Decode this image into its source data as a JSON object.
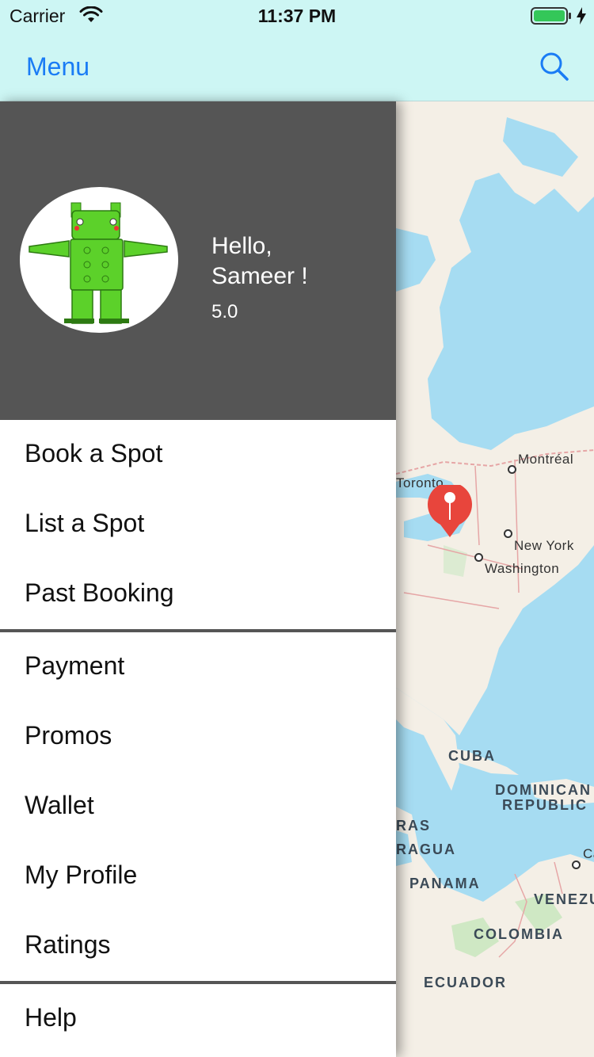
{
  "status_bar": {
    "carrier": "Carrier",
    "time": "11:37 PM"
  },
  "nav": {
    "title": "Menu",
    "icon": "search-icon",
    "accent_color": "#1a7cf5"
  },
  "profile": {
    "greeting_line1": "Hello,",
    "greeting_line2": "Sameer !",
    "rating": "5.0",
    "background_color": "#555555"
  },
  "menu_groups": [
    [
      "Book a Spot",
      "List a Spot",
      "Past Booking"
    ],
    [
      "Payment",
      "Promos",
      "Wallet",
      "My Profile",
      "Ratings"
    ],
    [
      "Help"
    ]
  ],
  "map": {
    "pin_color": "#e8453c",
    "labels": {
      "toronto": "Toronto",
      "montreal": "Montréal",
      "new_york": "New York",
      "washington": "Washington",
      "cuba": "CUBA",
      "dominican_1": "DOMINICAN",
      "dominican_2": "REPUBLIC",
      "honduras": "RAS",
      "nicaragua": "RAGUA",
      "panama": "PANAMA",
      "venezuela": "VENEZU",
      "caracas": "Ca",
      "colombia": "COLOMBIA",
      "ecuador": "ECUADOR"
    }
  }
}
